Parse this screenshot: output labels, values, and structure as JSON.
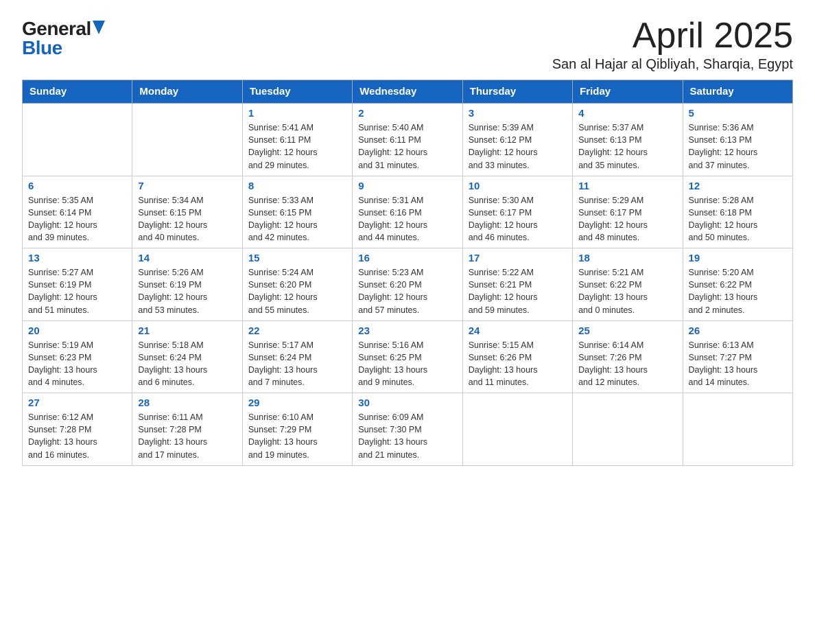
{
  "header": {
    "logo_general": "General",
    "logo_blue": "Blue",
    "month_title": "April 2025",
    "location": "San al Hajar al Qibliyah, Sharqia, Egypt"
  },
  "weekdays": [
    "Sunday",
    "Monday",
    "Tuesday",
    "Wednesday",
    "Thursday",
    "Friday",
    "Saturday"
  ],
  "weeks": [
    [
      {
        "day": "",
        "info": ""
      },
      {
        "day": "",
        "info": ""
      },
      {
        "day": "1",
        "info": "Sunrise: 5:41 AM\nSunset: 6:11 PM\nDaylight: 12 hours\nand 29 minutes."
      },
      {
        "day": "2",
        "info": "Sunrise: 5:40 AM\nSunset: 6:11 PM\nDaylight: 12 hours\nand 31 minutes."
      },
      {
        "day": "3",
        "info": "Sunrise: 5:39 AM\nSunset: 6:12 PM\nDaylight: 12 hours\nand 33 minutes."
      },
      {
        "day": "4",
        "info": "Sunrise: 5:37 AM\nSunset: 6:13 PM\nDaylight: 12 hours\nand 35 minutes."
      },
      {
        "day": "5",
        "info": "Sunrise: 5:36 AM\nSunset: 6:13 PM\nDaylight: 12 hours\nand 37 minutes."
      }
    ],
    [
      {
        "day": "6",
        "info": "Sunrise: 5:35 AM\nSunset: 6:14 PM\nDaylight: 12 hours\nand 39 minutes."
      },
      {
        "day": "7",
        "info": "Sunrise: 5:34 AM\nSunset: 6:15 PM\nDaylight: 12 hours\nand 40 minutes."
      },
      {
        "day": "8",
        "info": "Sunrise: 5:33 AM\nSunset: 6:15 PM\nDaylight: 12 hours\nand 42 minutes."
      },
      {
        "day": "9",
        "info": "Sunrise: 5:31 AM\nSunset: 6:16 PM\nDaylight: 12 hours\nand 44 minutes."
      },
      {
        "day": "10",
        "info": "Sunrise: 5:30 AM\nSunset: 6:17 PM\nDaylight: 12 hours\nand 46 minutes."
      },
      {
        "day": "11",
        "info": "Sunrise: 5:29 AM\nSunset: 6:17 PM\nDaylight: 12 hours\nand 48 minutes."
      },
      {
        "day": "12",
        "info": "Sunrise: 5:28 AM\nSunset: 6:18 PM\nDaylight: 12 hours\nand 50 minutes."
      }
    ],
    [
      {
        "day": "13",
        "info": "Sunrise: 5:27 AM\nSunset: 6:19 PM\nDaylight: 12 hours\nand 51 minutes."
      },
      {
        "day": "14",
        "info": "Sunrise: 5:26 AM\nSunset: 6:19 PM\nDaylight: 12 hours\nand 53 minutes."
      },
      {
        "day": "15",
        "info": "Sunrise: 5:24 AM\nSunset: 6:20 PM\nDaylight: 12 hours\nand 55 minutes."
      },
      {
        "day": "16",
        "info": "Sunrise: 5:23 AM\nSunset: 6:20 PM\nDaylight: 12 hours\nand 57 minutes."
      },
      {
        "day": "17",
        "info": "Sunrise: 5:22 AM\nSunset: 6:21 PM\nDaylight: 12 hours\nand 59 minutes."
      },
      {
        "day": "18",
        "info": "Sunrise: 5:21 AM\nSunset: 6:22 PM\nDaylight: 13 hours\nand 0 minutes."
      },
      {
        "day": "19",
        "info": "Sunrise: 5:20 AM\nSunset: 6:22 PM\nDaylight: 13 hours\nand 2 minutes."
      }
    ],
    [
      {
        "day": "20",
        "info": "Sunrise: 5:19 AM\nSunset: 6:23 PM\nDaylight: 13 hours\nand 4 minutes."
      },
      {
        "day": "21",
        "info": "Sunrise: 5:18 AM\nSunset: 6:24 PM\nDaylight: 13 hours\nand 6 minutes."
      },
      {
        "day": "22",
        "info": "Sunrise: 5:17 AM\nSunset: 6:24 PM\nDaylight: 13 hours\nand 7 minutes."
      },
      {
        "day": "23",
        "info": "Sunrise: 5:16 AM\nSunset: 6:25 PM\nDaylight: 13 hours\nand 9 minutes."
      },
      {
        "day": "24",
        "info": "Sunrise: 5:15 AM\nSunset: 6:26 PM\nDaylight: 13 hours\nand 11 minutes."
      },
      {
        "day": "25",
        "info": "Sunrise: 6:14 AM\nSunset: 7:26 PM\nDaylight: 13 hours\nand 12 minutes."
      },
      {
        "day": "26",
        "info": "Sunrise: 6:13 AM\nSunset: 7:27 PM\nDaylight: 13 hours\nand 14 minutes."
      }
    ],
    [
      {
        "day": "27",
        "info": "Sunrise: 6:12 AM\nSunset: 7:28 PM\nDaylight: 13 hours\nand 16 minutes."
      },
      {
        "day": "28",
        "info": "Sunrise: 6:11 AM\nSunset: 7:28 PM\nDaylight: 13 hours\nand 17 minutes."
      },
      {
        "day": "29",
        "info": "Sunrise: 6:10 AM\nSunset: 7:29 PM\nDaylight: 13 hours\nand 19 minutes."
      },
      {
        "day": "30",
        "info": "Sunrise: 6:09 AM\nSunset: 7:30 PM\nDaylight: 13 hours\nand 21 minutes."
      },
      {
        "day": "",
        "info": ""
      },
      {
        "day": "",
        "info": ""
      },
      {
        "day": "",
        "info": ""
      }
    ]
  ]
}
